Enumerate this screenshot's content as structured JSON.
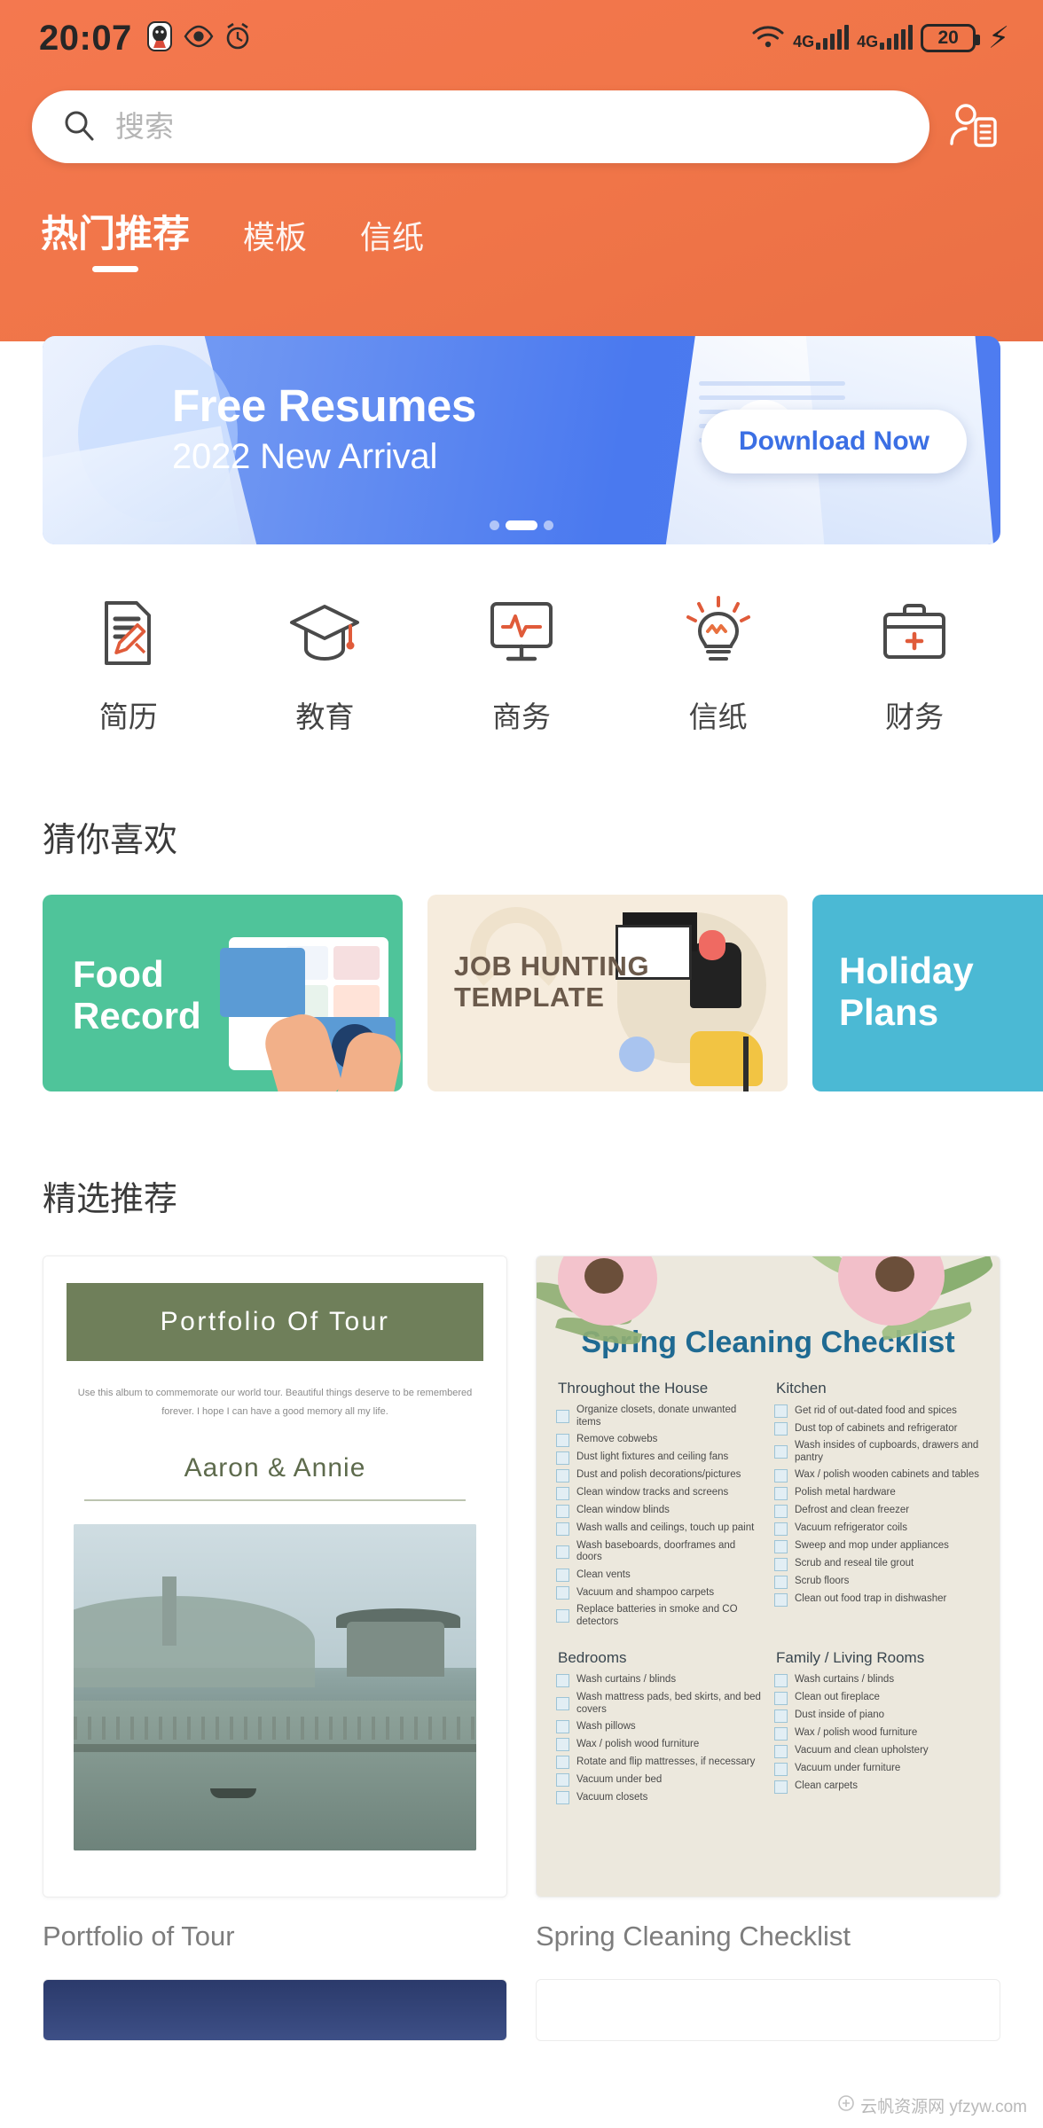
{
  "status_bar": {
    "time": "20:07",
    "left_icons": [
      "qq-penguin-icon",
      "eye-icon",
      "alarm-clock-icon"
    ],
    "wifi_icon": "wifi-icon",
    "network_1": "4G",
    "network_2": "4G",
    "battery_level": "20",
    "charging_icon": "lightning-bolt-icon"
  },
  "search": {
    "placeholder": "搜索",
    "value": "",
    "icon": "search-icon",
    "profile_icon": "user-profile-icon"
  },
  "tabs": [
    {
      "label": "热门推荐",
      "active": true
    },
    {
      "label": "模板",
      "active": false
    },
    {
      "label": "信纸",
      "active": false
    }
  ],
  "banner": {
    "title": "Free Resumes",
    "subtitle": "2022 New Arrival",
    "cta_label": "Download Now",
    "dots": 3,
    "active_dot": 1
  },
  "categories": [
    {
      "label": "简历",
      "icon": "document-pencil-icon"
    },
    {
      "label": "教育",
      "icon": "graduation-cap-icon"
    },
    {
      "label": "商务",
      "icon": "monitor-chart-icon"
    },
    {
      "label": "信纸",
      "icon": "lightbulb-icon"
    },
    {
      "label": "财务",
      "icon": "briefcase-plus-icon"
    }
  ],
  "guess_section": {
    "title": "猜你喜欢",
    "cards": [
      {
        "title": "Food\nRecord",
        "line1": "Food",
        "line2": "Record",
        "color": "#4fc49a"
      },
      {
        "title": "JOB HUNTING TEMPLATE",
        "line1": "JOB HUNTING",
        "line2": "TEMPLATE",
        "color": "#f6ecdd"
      },
      {
        "title": "Holiday Plans",
        "line1": "Holiday",
        "line2": "Plans",
        "color": "#4bb9d4"
      }
    ]
  },
  "featured_section": {
    "title": "精选推荐",
    "items": [
      {
        "caption": "Portfolio of Tour"
      },
      {
        "caption": "Spring Cleaning Checklist"
      }
    ]
  },
  "portfolio_card": {
    "band_title": "Portfolio Of Tour",
    "description": "Use this album to commemorate our world tour. Beautiful things deserve to be remembered forever. I hope I can have a good memory all my life.",
    "names": "Aaron & Annie"
  },
  "checklist_card": {
    "title": "Spring Cleaning Checklist",
    "sections": [
      {
        "heading": "Throughout the House",
        "items": [
          "Organize closets, donate unwanted items",
          "Remove cobwebs",
          "Dust light fixtures and ceiling fans",
          "Dust and polish decorations/pictures",
          "Clean window tracks and screens",
          "Clean window blinds",
          "Wash walls and ceilings, touch up paint",
          "Wash baseboards, doorframes and doors",
          "Clean vents",
          "Vacuum and shampoo carpets",
          "Replace batteries in smoke and CO detectors"
        ]
      },
      {
        "heading": "Kitchen",
        "items": [
          "Get rid of out-dated food and spices",
          "Dust top of cabinets and refrigerator",
          "Wash insides of cupboards, drawers and pantry",
          "Wax / polish wooden cabinets and tables",
          "Polish metal hardware",
          "Defrost and clean freezer",
          "Vacuum refrigerator coils",
          "Sweep and mop under appliances",
          "Scrub and reseal tile grout",
          "Scrub floors",
          "Clean out food trap in dishwasher"
        ]
      },
      {
        "heading": "Bedrooms",
        "items": [
          "Wash curtains / blinds",
          "Wash mattress pads, bed skirts, and bed covers",
          "Wash pillows",
          "Wax / polish wood furniture",
          "Rotate and flip mattresses, if necessary",
          "Vacuum under bed",
          "Vacuum closets"
        ]
      },
      {
        "heading": "Family / Living Rooms",
        "items": [
          "Wash curtains / blinds",
          "Clean out fireplace",
          "Dust inside of piano",
          "Wax / polish wood furniture",
          "Vacuum and clean upholstery",
          "Vacuum under furniture",
          "Clean carpets"
        ]
      }
    ]
  },
  "watermark": "云帆资源网 yfzyw.com",
  "colors": {
    "brand_orange": "#f07548",
    "banner_blue": "#4a79ef",
    "accent_red": "#e05b3a",
    "text_dark": "#3a3a3a",
    "text_muted": "#7d7d7d"
  }
}
